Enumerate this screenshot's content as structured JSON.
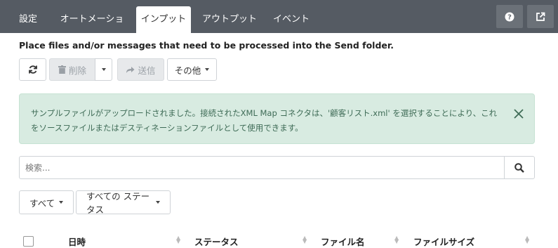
{
  "tabs": [
    {
      "label": "設定"
    },
    {
      "label": "オートメーション"
    },
    {
      "label": "インプット",
      "active": true
    },
    {
      "label": "アウトプット"
    },
    {
      "label": "イベント"
    }
  ],
  "top_icons": [
    "help-icon",
    "external-link-icon"
  ],
  "description": "Place files and/or messages that need to be processed into the  Send folder.",
  "toolbar": {
    "refresh_icon": "refresh-icon",
    "delete_label": "削除",
    "send_label": "送信",
    "more_label": "その他"
  },
  "alert": {
    "message": "サンプルファイルがアップロードされました。接続されたXML Map コネクタは、'顧客リスト.xml' を選択することにより、これをソースファイルまたはデスティネーションファイルとして使用できます。",
    "close_icon": "close-icon"
  },
  "search": {
    "placeholder": "検索...",
    "value": ""
  },
  "filters": {
    "all_label": "すべて",
    "status_label": "すべての ステータス"
  },
  "table": {
    "columns": [
      "日時",
      "ステータス",
      "ファイル名",
      "ファイルサイズ"
    ]
  },
  "colors": {
    "topbar": "#555b63",
    "alert_bg": "#d8ebe1",
    "alert_text": "#3e6b56"
  }
}
